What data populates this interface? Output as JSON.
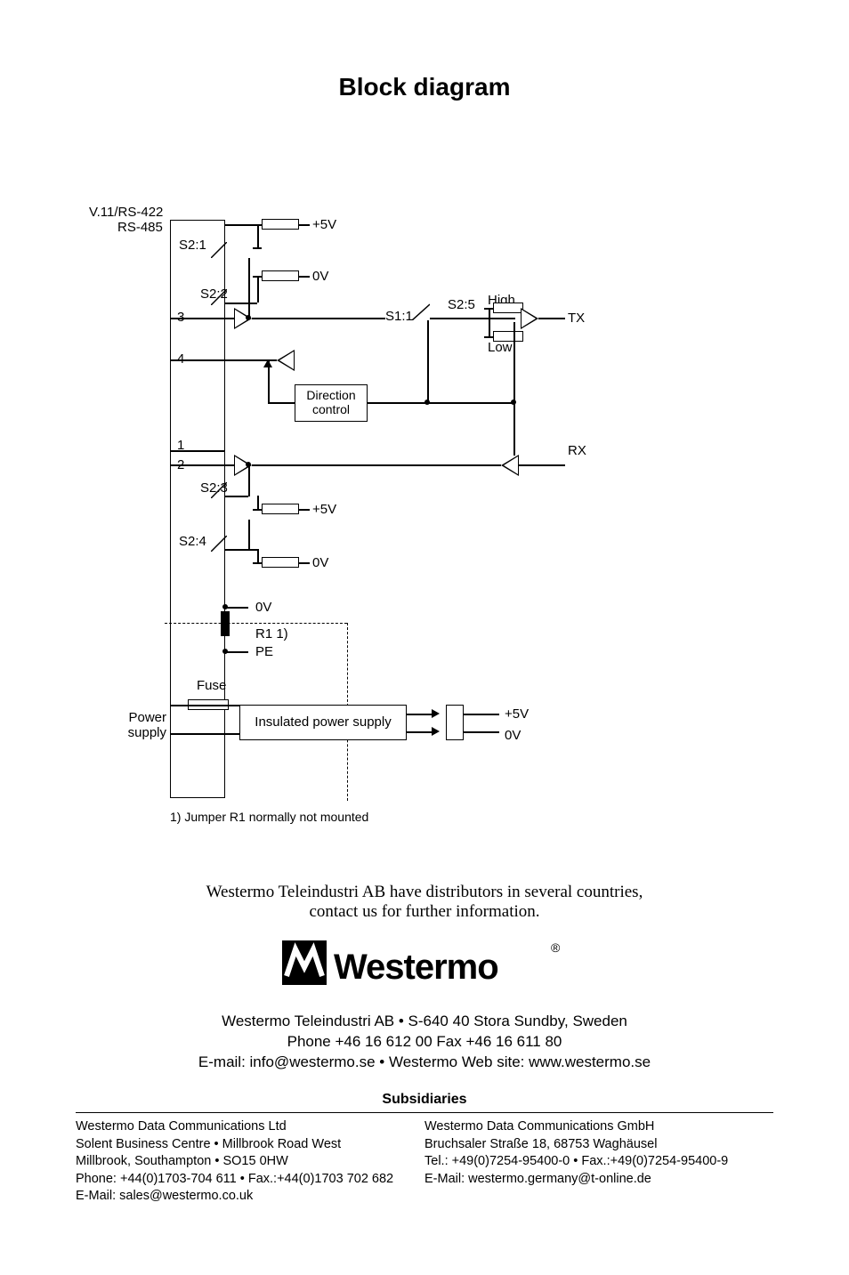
{
  "title": "Block diagram",
  "diagram": {
    "protocol1": "V.11/RS-422",
    "protocol2": "RS-485",
    "s21": "S2:1",
    "s22": "S2:2",
    "s23": "S2:3",
    "s24": "S2:4",
    "s25": "S2:5",
    "s11": "S1:1",
    "plus5v": "+5V",
    "zero_v": "0V",
    "pin1": "1",
    "pin2": "2",
    "pin3": "3",
    "pin4": "4",
    "dir_control_l1": "Direction",
    "dir_control_l2": "control",
    "high": "High",
    "low": "Low",
    "tx": "TX",
    "rx": "RX",
    "r1": "R1 1)",
    "pe": "PE",
    "fuse": "Fuse",
    "power": "Power",
    "supply": "supply",
    "insulated": "Insulated power supply",
    "footnote": "1) Jumper R1 normally not mounted"
  },
  "distributors_l1": "Westermo Teleindustri AB have distributors in several countries,",
  "distributors_l2": "contact us for further information.",
  "logo_text": "Westermo",
  "company_l1": "Westermo Teleindustri AB • S-640 40 Stora Sundby, Sweden",
  "company_l2": "Phone +46 16 612 00  Fax +46 16 611 80",
  "company_l3": "E-mail: info@westermo.se • Westermo Web site: www.westermo.se",
  "subsidiaries_title": "Subsidiaries",
  "sub_uk": {
    "l1": "Westermo Data Communications Ltd",
    "l2": "Solent Business Centre • Millbrook Road West",
    "l3": "Millbrook, Southampton • SO15 0HW",
    "l4": "Phone: +44(0)1703-704 611 • Fax.:+44(0)1703 702 682",
    "l5": "E-Mail: sales@westermo.co.uk"
  },
  "sub_de": {
    "l1": "Westermo Data Communications GmbH",
    "l2": "Bruchsaler Straße 18, 68753 Waghäusel",
    "l3": "Tel.: +49(0)7254-95400-0 • Fax.:+49(0)7254-95400-9",
    "l4": "E-Mail: westermo.germany@t-online.de"
  }
}
